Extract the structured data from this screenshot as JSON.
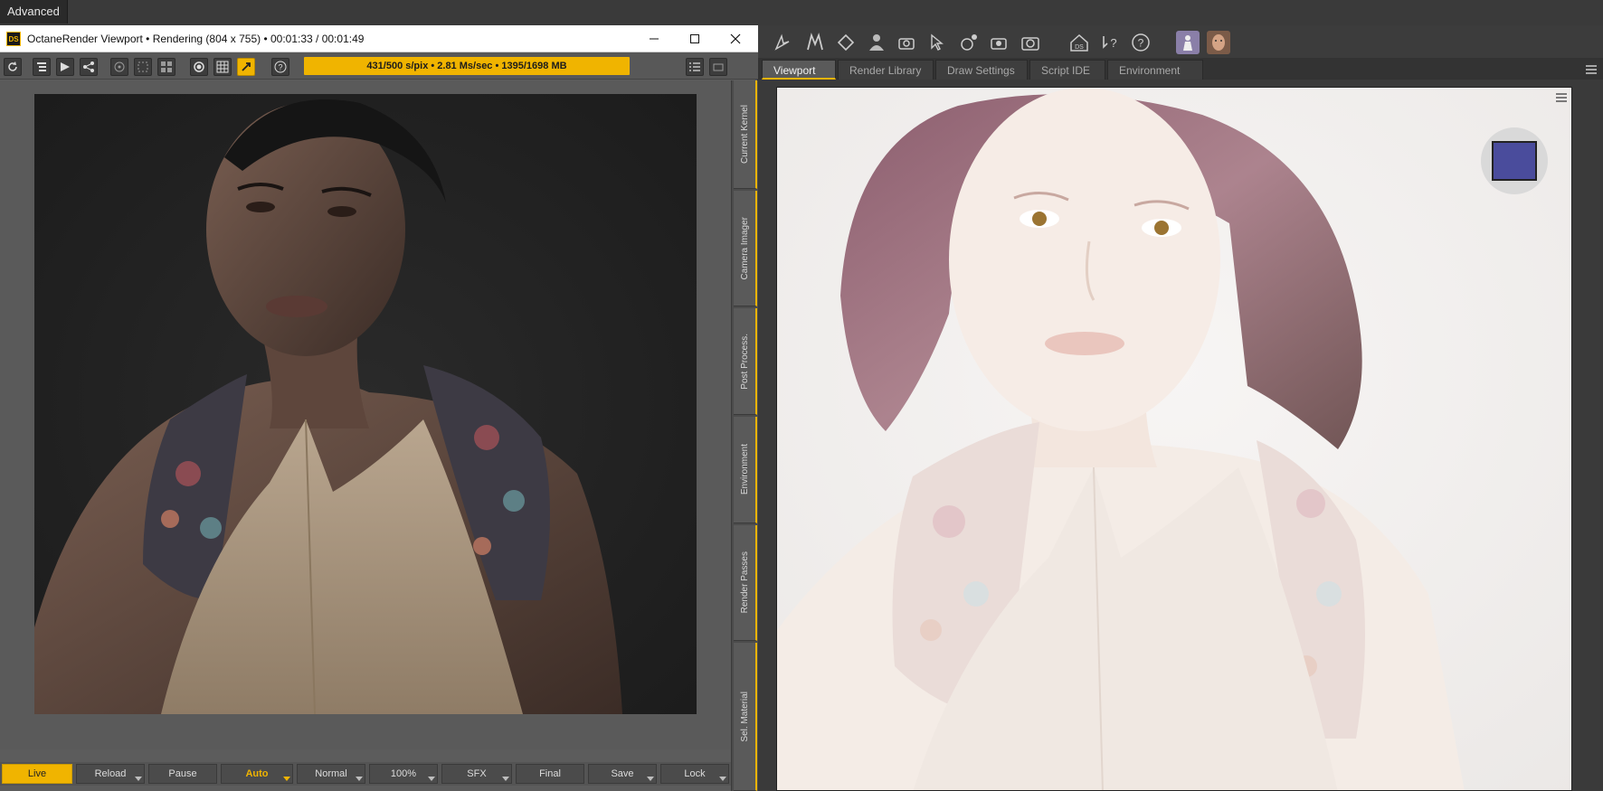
{
  "workspace": {
    "label": "Advanced"
  },
  "octane": {
    "title": "OctaneRender Viewport • Rendering (804 x 755) • 00:01:33 / 00:01:49",
    "status": "431/500 s/pix • 2.81 Ms/sec • 1395/1698 MB",
    "side_tabs": [
      "Current Kernel",
      "Camera Imager",
      "Post Process.",
      "Environment",
      "Render Passes",
      "Sel. Material"
    ],
    "bottom_buttons": {
      "live": "Live",
      "reload": "Reload",
      "pause": "Pause",
      "auto": "Auto",
      "normal": "Normal",
      "zoom": "100%",
      "sfx": "SFX",
      "final": "Final",
      "save": "Save",
      "lock": "Lock"
    }
  },
  "daz": {
    "tabs": [
      "Viewport",
      "Render Library",
      "Draw Settings",
      "Script IDE",
      "Environment"
    ],
    "active_tab": "Viewport"
  },
  "colors": {
    "accent": "#f0b400",
    "panel": "#5c5c5c",
    "dark": "#3a3a3a"
  }
}
